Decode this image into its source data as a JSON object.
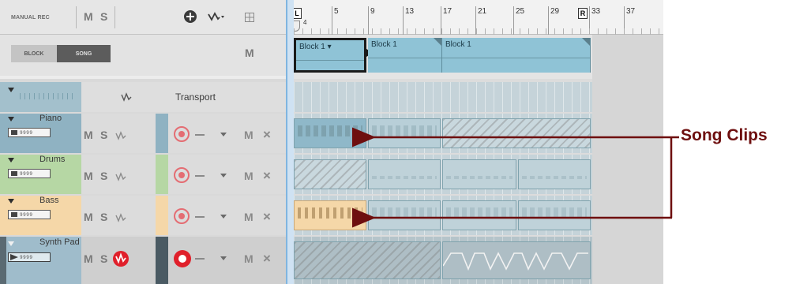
{
  "header": {
    "manual_rec": "MANUAL REC",
    "m": "M",
    "s": "S"
  },
  "mode": {
    "block": "BLOCK",
    "song": "SONG",
    "m": "M"
  },
  "tracks": [
    {
      "name": "Transport",
      "color": "#8fb2c2"
    },
    {
      "name": "Piano",
      "color": "#8fb2c2",
      "m": "M",
      "s": "S",
      "x": "×",
      "m2": "M"
    },
    {
      "name": "Drums",
      "color": "#b6d7a4",
      "m": "M",
      "s": "S",
      "x": "×",
      "m2": "M"
    },
    {
      "name": "Bass",
      "color": "#f5d7a8",
      "m": "M",
      "s": "S",
      "x": "×",
      "m2": "M"
    },
    {
      "name": "Synth Pad",
      "color": "#8fb2c2",
      "m": "M",
      "s": "S",
      "x": "×",
      "m2": "M"
    }
  ],
  "ruler": {
    "bars": [
      "5",
      "9",
      "13",
      "17",
      "21",
      "25",
      "29",
      "33",
      "37"
    ],
    "start_marker": "L",
    "end_marker": "R",
    "start_sub": "4"
  },
  "blocks": [
    {
      "label": "Block 1 ▾"
    },
    {
      "label": "Block 1"
    },
    {
      "label": "Block 1"
    }
  ],
  "annotation": {
    "text": "Song Clips",
    "color": "#6e0f0f"
  }
}
